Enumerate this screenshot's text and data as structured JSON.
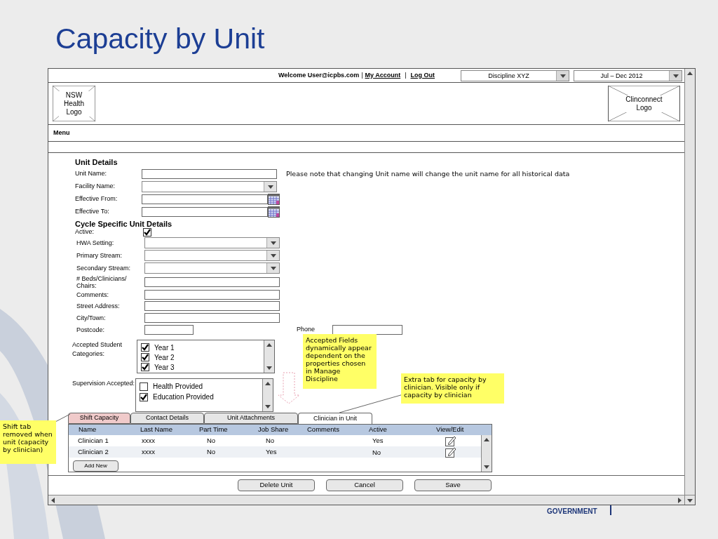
{
  "slide": {
    "title": "Capacity by Unit",
    "footer_logo": {
      "line_1": "GOVERNMENT"
    }
  },
  "header": {
    "welcome": "Welcome User@icpbs.com",
    "separator_1": "|",
    "account_link": "My Account",
    "separator_2": "|",
    "logout_link": "Log Out",
    "dropdowns": [
      {
        "value": "Discipline XYZ"
      },
      {
        "value": "Jul – Dec 2012"
      }
    ]
  },
  "logos": [
    {
      "text": "NSW Health Logo"
    },
    {
      "text": "Clinconnect Logo"
    }
  ],
  "menu": {
    "label": "Menu"
  },
  "unit_details": {
    "heading": "Unit Details",
    "note": "Please note that changing Unit name will change the unit name for all historical data",
    "fields": [
      {
        "label": "Unit Name:",
        "kind": "text"
      },
      {
        "label": "Facility Name:",
        "kind": "dropdown"
      },
      {
        "label": "Effective From:",
        "kind": "date"
      },
      {
        "label": "Effective To:",
        "kind": "date"
      }
    ]
  },
  "cycle_details": {
    "heading": "Cycle Specific Unit Details",
    "active": {
      "label": "Active:",
      "checked": true
    },
    "fields": [
      {
        "label": "HWA Setting:",
        "kind": "dropdown"
      },
      {
        "label": "Primary Stream:",
        "kind": "dropdown"
      },
      {
        "label": "Secondary Stream:",
        "kind": "dropdown"
      },
      {
        "label": "# Beds/Clinicians/ Chairs:",
        "kind": "text"
      },
      {
        "label": "Comments:",
        "kind": "text"
      },
      {
        "label": "Street Address:",
        "kind": "text"
      },
      {
        "label": "City/Town:",
        "kind": "text"
      },
      {
        "label": "Postcode:",
        "kind": "short"
      }
    ],
    "phone": {
      "label": "Phone"
    }
  },
  "student_categories": {
    "label": "Accepted Student Categories:",
    "options": [
      {
        "label": "Year 1",
        "checked": true
      },
      {
        "label": "Year 2",
        "checked": true
      },
      {
        "label": "Year 3",
        "checked": true
      }
    ]
  },
  "supervision": {
    "label": "Supervision Accepted:",
    "options": [
      {
        "label": "Health Provided",
        "checked": false
      },
      {
        "label": "Education Provided",
        "checked": true
      }
    ]
  },
  "tabs": [
    {
      "label": "Shift Capacity",
      "selected": false,
      "highlighted": true
    },
    {
      "label": "Contact Details",
      "selected": false,
      "highlighted": false
    },
    {
      "label": "Unit Attachments",
      "selected": false,
      "highlighted": false
    },
    {
      "label": "Clinician in Unit",
      "selected": true,
      "highlighted": false
    }
  ],
  "table": {
    "columns": [
      "Name",
      "Last Name",
      "Part Time",
      "Job Share",
      "Comments",
      "Active",
      "View/Edit"
    ],
    "rows": [
      {
        "name": "Clinician 1",
        "last_name": "xxxx",
        "part_time": "No",
        "job_share": "No",
        "active": "Yes"
      },
      {
        "name": "Clinician 2",
        "last_name": "xxxx",
        "part_time": "No",
        "job_share": "Yes",
        "active": "No"
      }
    ],
    "add_button": "Add New"
  },
  "actions": [
    "Delete Unit",
    "Cancel",
    "Save"
  ],
  "notes": [
    {
      "text": "Accepted Fields dynamically appear dependent on the properties chosen in Manage Discipline"
    },
    {
      "text": "Extra tab for capacity by clinician. Visible only if capacity by clinician"
    },
    {
      "text": "Shift tab removed when unit (capacity by clinician)"
    }
  ]
}
